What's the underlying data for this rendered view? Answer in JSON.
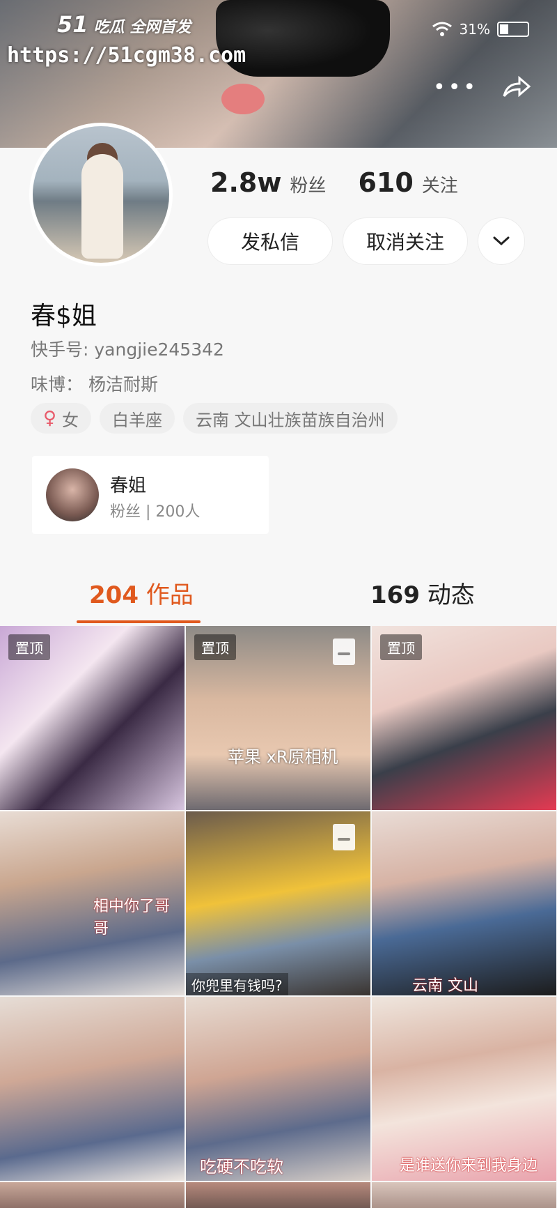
{
  "watermark": {
    "logo": "51",
    "logo_text": "吃瓜 全网首发",
    "url": "https://51cgm38.com"
  },
  "status": {
    "battery": "31%"
  },
  "profile": {
    "fans_count": "2.8w",
    "fans_label": "粉丝",
    "following_count": "610",
    "following_label": "关注",
    "message_button": "发私信",
    "unfollow_button": "取消关注",
    "name": "春$姐",
    "kuaishou_id": "快手号: yangjie245342",
    "weibo": "味博： 杨洁耐斯",
    "tags": {
      "gender": "女",
      "zodiac": "白羊座",
      "location": "云南 文山壮族苗族自治州"
    }
  },
  "fan_group": {
    "name": "春姐",
    "count": "粉丝 | 200人"
  },
  "tabs": {
    "works_count": "204",
    "works_label": "作品",
    "moments_count": "169",
    "moments_label": "动态"
  },
  "grid": {
    "pinned_label": "置顶",
    "captions": {
      "t2": "苹果 xR原相机",
      "t4": "相中你了哥哥",
      "t5": "你兜里有钱吗?",
      "t6": "云南 文山",
      "t8": "吃硬不吃软",
      "t9": "是谁送你来到我身边"
    }
  }
}
